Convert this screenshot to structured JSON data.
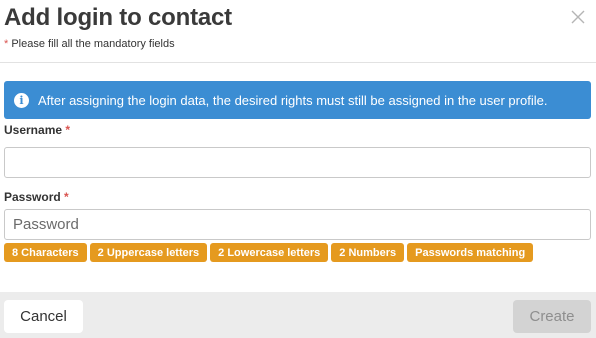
{
  "dialog": {
    "title": "Add login to contact",
    "mandatory_star": "*",
    "mandatory_note": "Please fill all the mandatory fields"
  },
  "info": {
    "icon": "info-icon",
    "text": "After assigning the login data, the desired rights must still be assigned in the user profile."
  },
  "form": {
    "username": {
      "label": "Username",
      "required_marker": "*",
      "value": "",
      "placeholder": ""
    },
    "password": {
      "label": "Password",
      "required_marker": "*",
      "value": "",
      "placeholder": "Password"
    }
  },
  "requirements": [
    "8  Characters",
    "2  Uppercase letters",
    "2  Lowercase letters",
    "2  Numbers",
    "Passwords matching"
  ],
  "footer": {
    "cancel_label": "Cancel",
    "create_label": "Create"
  },
  "colors": {
    "info_bg": "#3b8dd3",
    "requirement_bg": "#e59a1f",
    "required_star": "#d9534f",
    "footer_bg": "#ececec",
    "create_disabled_bg": "#d3d3d3"
  }
}
